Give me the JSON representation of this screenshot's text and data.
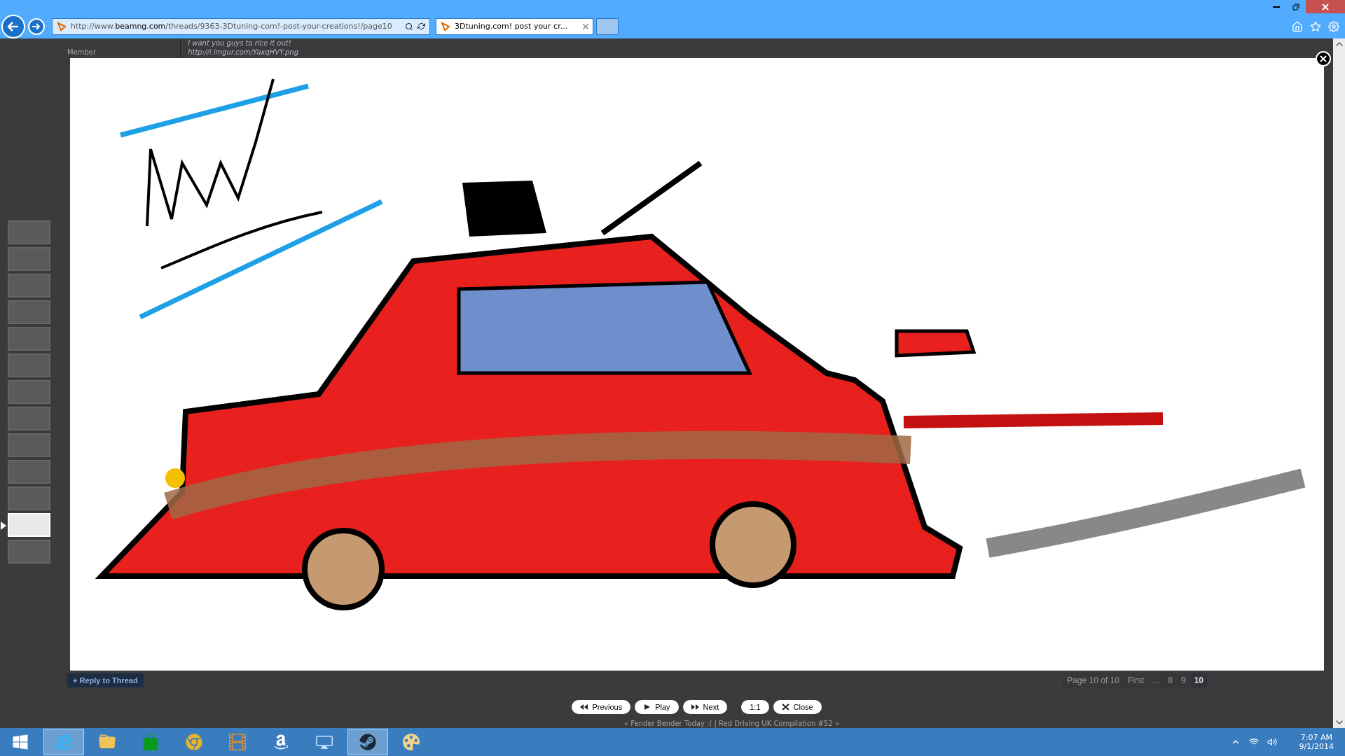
{
  "browser": {
    "address": "http://www.**beamng.com**/threads/9363-3Dtuning-com!-post-your-creations!/page10",
    "tabs": [
      {
        "title": "3Dtuning.com! post your cr...",
        "selected": true
      }
    ]
  },
  "page": {
    "author_role": "Member",
    "post_lines": [
      "I want you guys to rice it out!",
      "http://i.imgur.com/YaxqHVY.png"
    ],
    "reply_button": "+ Reply to Thread",
    "pagination": {
      "summary": "Page 10 of 10",
      "first": "First",
      "ellipsis": "...",
      "pages": [
        {
          "label": "8",
          "selected": false
        },
        {
          "label": "9",
          "selected": false
        },
        {
          "label": "10",
          "selected": true
        }
      ]
    },
    "thread_nav": "« Fender Bender Today :( | Red Driving UK Compilation #52 »"
  },
  "lightbox": {
    "thumbnails": [
      {
        "selected": false
      },
      {
        "selected": false
      },
      {
        "selected": false
      },
      {
        "selected": false
      },
      {
        "selected": false
      },
      {
        "selected": false
      },
      {
        "selected": false
      },
      {
        "selected": false
      },
      {
        "selected": false
      },
      {
        "selected": false
      },
      {
        "selected": false
      },
      {
        "selected": true
      },
      {
        "selected": false
      }
    ],
    "controls": [
      {
        "kind": "previous",
        "label": "Previous"
      },
      {
        "kind": "play",
        "label": "Play"
      },
      {
        "kind": "next",
        "label": "Next"
      },
      {
        "kind": "actual-size",
        "label": "1:1"
      },
      {
        "kind": "close",
        "label": "Close"
      }
    ]
  },
  "taskbar": {
    "apps": [
      {
        "kind": "ie",
        "active": true
      },
      {
        "kind": "folder",
        "active": false
      },
      {
        "kind": "store",
        "active": false
      },
      {
        "kind": "chrome",
        "active": false
      },
      {
        "kind": "movie",
        "active": false
      },
      {
        "kind": "amazon",
        "active": false
      },
      {
        "kind": "control",
        "active": false
      },
      {
        "kind": "steam",
        "active": true
      },
      {
        "kind": "paint",
        "active": false
      }
    ],
    "clock": {
      "time": "7:07 AM",
      "date": "9/1/2014"
    }
  }
}
